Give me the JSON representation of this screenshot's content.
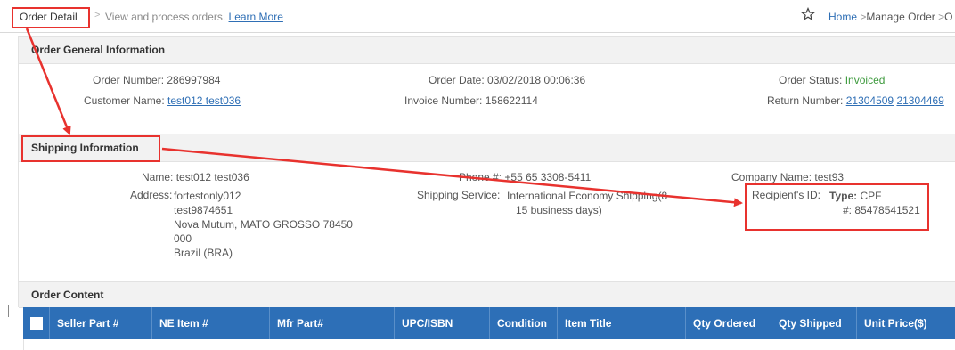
{
  "header": {
    "title": "Order Detail",
    "separator": ">",
    "description": "View and process orders.",
    "learn_more": "Learn More",
    "nav": {
      "home": "Home",
      "manage": "Manage Order",
      "cut": "O"
    }
  },
  "general": {
    "title": "Order General Information",
    "order_number_label": "Order Number:",
    "order_number": "286997984",
    "customer_name_label": "Customer Name:",
    "customer_name": "test012 test036",
    "order_date_label": "Order Date:",
    "order_date": "03/02/2018 00:06:36",
    "invoice_number_label": "Invoice Number:",
    "invoice_number": "158622114",
    "order_status_label": "Order Status:",
    "order_status": "Invoiced",
    "return_number_label": "Return Number:",
    "return_numbers": [
      "21304509",
      "21304469"
    ]
  },
  "shipping": {
    "title": "Shipping Information",
    "name_label": "Name:",
    "name": "test012 test036",
    "address_label": "Address:",
    "address_lines": [
      "fortestonly012",
      "test9874651",
      "Nova Mutum, MATO GROSSO 78450",
      "000",
      "Brazil (BRA)"
    ],
    "phone_label": "Phone #:",
    "phone": "+55 65 3308-5411",
    "service_label": "Shipping Service:",
    "service_lines": [
      "International Economy Shipping(8-",
      "15 business days)"
    ],
    "company_label": "Company Name:",
    "company": "test93",
    "recipient_label": "Recipient's ID:",
    "recipient_type_label": "Type:",
    "recipient_type": "CPF",
    "recipient_number": "#: 85478541521"
  },
  "content": {
    "title": "Order Content",
    "columns": [
      "Seller Part #",
      "NE Item #",
      "Mfr Part#",
      "UPC/ISBN",
      "Condition",
      "Item Title",
      "Qty Ordered",
      "Qty Shipped",
      "Unit Price($)"
    ]
  },
  "colors": {
    "accent": "#2d6fb7",
    "annotation": "#e8322e",
    "status_green": "#3d9a3d",
    "link": "#2f6fb5"
  },
  "icons": [
    "star-icon",
    "checkbox-icon"
  ]
}
